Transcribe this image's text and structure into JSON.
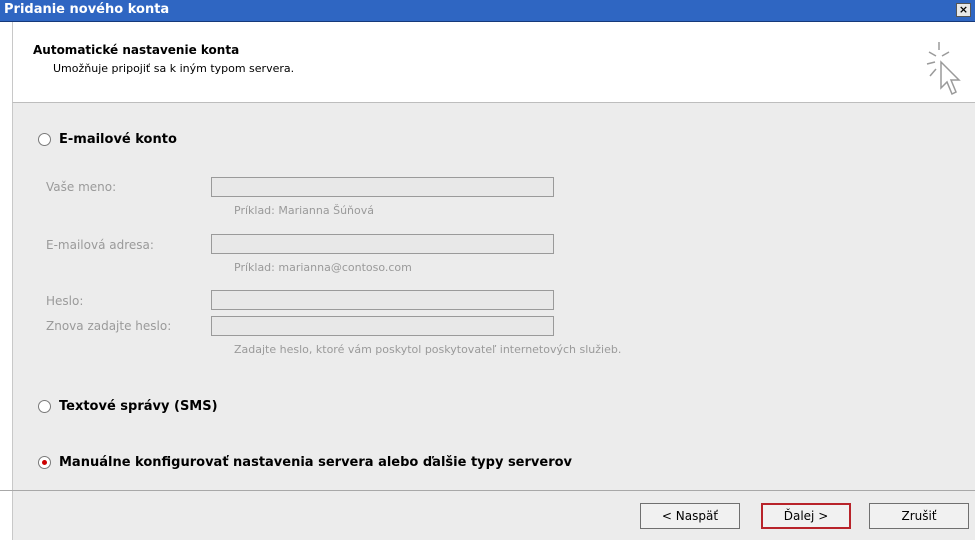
{
  "window": {
    "title": "Pridanie nového konta",
    "close_glyph": "×"
  },
  "header": {
    "title": "Automatické nastavenie konta",
    "subtitle": "Umožňuje pripojiť sa k iným typom servera.",
    "icon": "wizard-cursor-icon"
  },
  "options": {
    "email_account": {
      "label": "E-mailové konto",
      "selected": false
    },
    "sms": {
      "label": "Textové správy (SMS)",
      "selected": false
    },
    "manual": {
      "label": "Manuálne konfigurovať nastavenia servera alebo ďalšie typy serverov",
      "selected": true
    }
  },
  "fields": {
    "name": {
      "label": "Vaše meno:",
      "value": "",
      "hint": "Príklad: Marianna Šúňová"
    },
    "email": {
      "label": "E-mailová adresa:",
      "value": "",
      "hint": "Príklad: marianna@contoso.com"
    },
    "password": {
      "label": "Heslo:",
      "value": ""
    },
    "password_confirm": {
      "label": "Znova zadajte heslo:",
      "value": ""
    },
    "password_hint": "Zadajte heslo, ktoré vám poskytol poskytovateľ internetových služieb."
  },
  "buttons": {
    "back": "< Naspäť",
    "next": "Ďalej >",
    "cancel": "Zrušiť"
  },
  "colors": {
    "titlebar": "#2f66c2",
    "radio_selected": "#cc0000",
    "disabled_text": "#9a9a9a",
    "primary_border": "#b8232a"
  }
}
